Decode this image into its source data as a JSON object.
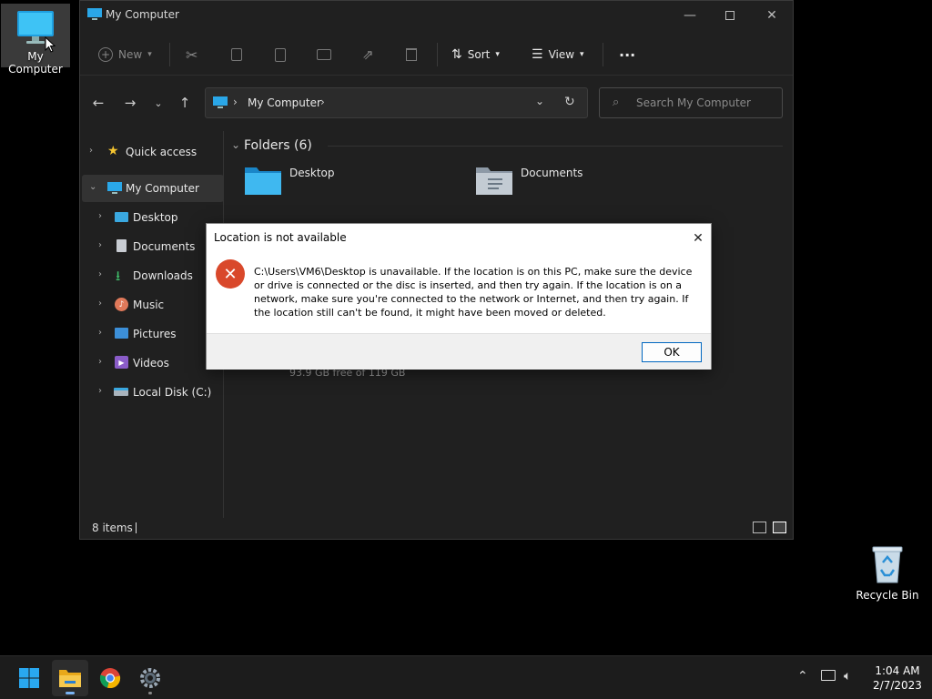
{
  "desktop": {
    "my_computer_label": "My Computer",
    "recycle_bin_label": "Recycle Bin"
  },
  "window": {
    "title": "My Computer",
    "toolbar": {
      "new_label": "New",
      "sort_label": "Sort",
      "view_label": "View"
    },
    "address": {
      "breadcrumb": "My Computer",
      "search_placeholder": "Search My Computer"
    },
    "sidebar": {
      "items": [
        {
          "label": "Quick access"
        },
        {
          "label": "My Computer"
        },
        {
          "label": "Desktop"
        },
        {
          "label": "Documents"
        },
        {
          "label": "Downloads"
        },
        {
          "label": "Music"
        },
        {
          "label": "Pictures"
        },
        {
          "label": "Videos"
        },
        {
          "label": "Local Disk (C:)"
        }
      ]
    },
    "content": {
      "section_title": "Folders (6)",
      "folders": [
        {
          "label": "Desktop"
        },
        {
          "label": "Documents"
        }
      ],
      "disk_free": "93.9 GB free of 119 GB"
    },
    "status": {
      "item_count": "8 items"
    }
  },
  "dialog": {
    "title": "Location is not available",
    "message": "C:\\Users\\VM6\\Desktop is unavailable. If the location is on this PC, make sure the device or drive is connected or the disc is inserted, and then try again. If the location is on a network, make sure you're connected to the network or Internet, and then try again. If the location still can't be found, it might have been moved or deleted.",
    "ok_label": "OK"
  },
  "taskbar": {
    "time": "1:04 AM",
    "date": "2/7/2023"
  },
  "colors": {
    "accent": "#0067c0",
    "error": "#d9482b",
    "window_bg": "#202020"
  }
}
